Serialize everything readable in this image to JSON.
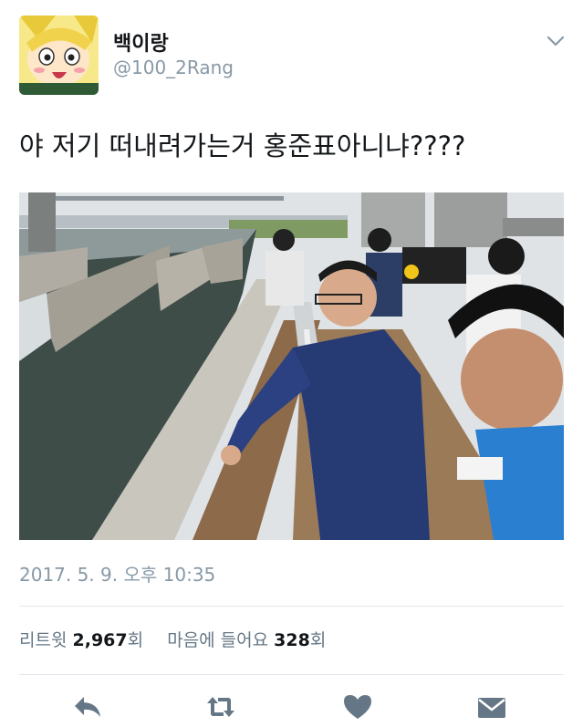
{
  "user": {
    "display_name": "백이랑",
    "handle": "@100_2Rang"
  },
  "tweet": {
    "text": "야 저기 떠내려가는거 홍준표아니냐????",
    "timestamp": "2017. 5. 9. 오후 10:35"
  },
  "stats": {
    "retweet_label": "리트윗",
    "retweet_count": "2,967",
    "retweet_unit": "회",
    "like_label": "마음에 들어요",
    "like_count": "328",
    "like_unit": "회"
  },
  "icons": {
    "menu": "chevron-down-icon",
    "reply": "reply-icon",
    "retweet": "retweet-icon",
    "like": "heart-icon",
    "message": "envelope-icon"
  },
  "colors": {
    "secondary_text": "#8899a6",
    "icon": "#657786",
    "divider": "#e1e8ed"
  }
}
